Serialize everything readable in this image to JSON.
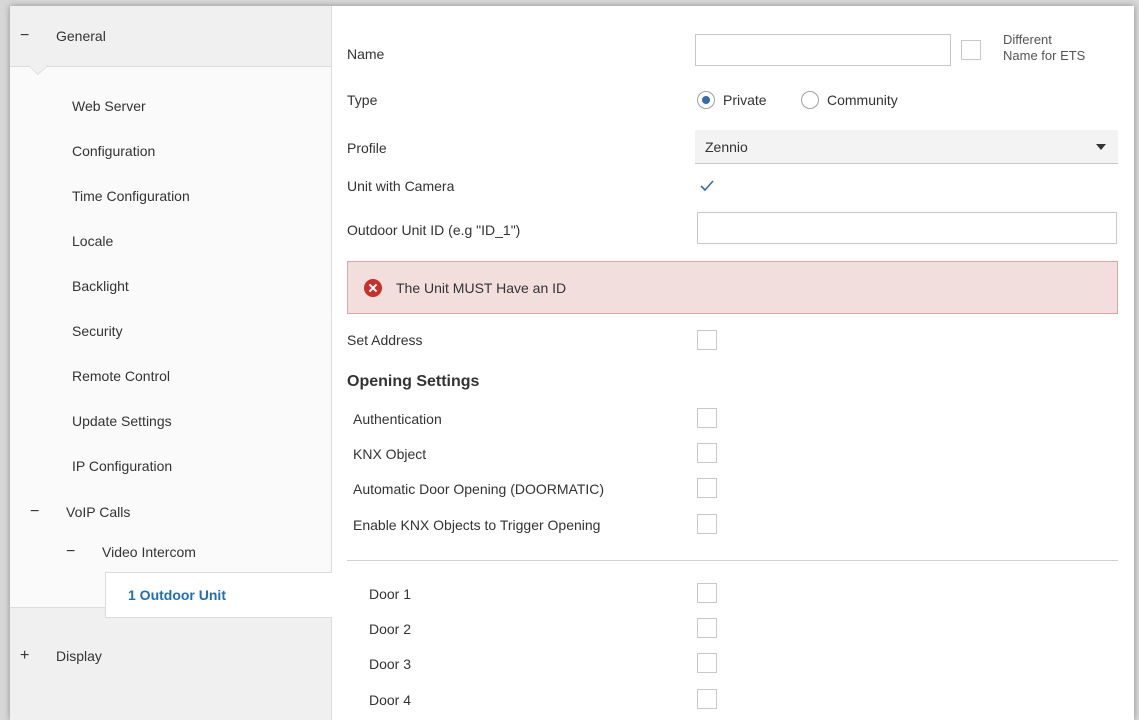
{
  "sidebar": {
    "general": {
      "sign": "−",
      "label": "General"
    },
    "items": [
      {
        "label": "Web Server"
      },
      {
        "label": "Configuration"
      },
      {
        "label": "Time Configuration"
      },
      {
        "label": "Locale"
      },
      {
        "label": "Backlight"
      },
      {
        "label": "Security"
      },
      {
        "label": "Remote Control"
      },
      {
        "label": "Update Settings"
      },
      {
        "label": "IP Configuration"
      }
    ],
    "voip": {
      "sign": "−",
      "label": "VoIP Calls"
    },
    "video_intercom": {
      "sign": "−",
      "label": "Video Intercom"
    },
    "active_item": {
      "label": "1 Outdoor Unit"
    },
    "display": {
      "sign": "+",
      "label": "Display"
    }
  },
  "form": {
    "name_label": "Name",
    "name_value": "",
    "different_name_label_line1": "Different",
    "different_name_label_line2": "Name for ETS",
    "different_name_checked": false,
    "type_label": "Type",
    "type_options": [
      "Private",
      "Community"
    ],
    "type_selected": "Private",
    "profile_label": "Profile",
    "profile_value": "Zennio",
    "unit_camera_label": "Unit with Camera",
    "unit_camera_checked": true,
    "outdoor_id_label": "Outdoor Unit ID (e.g \"ID_1\")",
    "outdoor_id_value": "",
    "error_message": "The Unit MUST Have an ID",
    "set_address_label": "Set Address",
    "opening_settings_title": "Opening Settings",
    "opening_items": [
      {
        "label": "Authentication",
        "checked": false
      },
      {
        "label": "KNX Object",
        "checked": false
      },
      {
        "label": "Automatic Door Opening (DOORMATIC)",
        "checked": false
      },
      {
        "label": "Enable KNX Objects to Trigger Opening",
        "checked": false
      }
    ],
    "doors": [
      {
        "label": "Door 1",
        "checked": false
      },
      {
        "label": "Door 2",
        "checked": false
      },
      {
        "label": "Door 3",
        "checked": false
      },
      {
        "label": "Door 4",
        "checked": false
      }
    ]
  },
  "colors": {
    "accent": "#1f6fb5",
    "error_bg": "#f3dede",
    "error_icon": "#c9302c"
  }
}
